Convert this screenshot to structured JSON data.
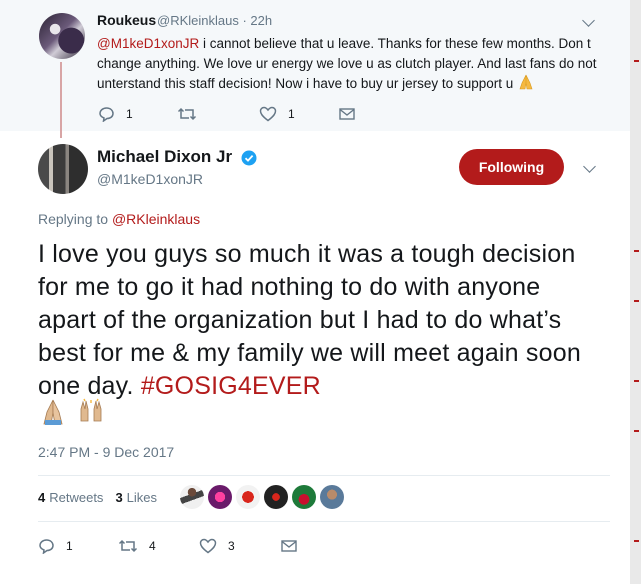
{
  "reply_tweet": {
    "name": "Roukeus",
    "handle": "@RKleinklaus · 22h",
    "mention": "@M1keD1xonJR",
    "text": " i cannot believe that u leave. Thanks for these few months. Don t change anything. We love ur energy we love u as clutch player. And last fans do not unterstand this staff decision! Now i have to buy ur jersey to support u ",
    "reply_count": "1",
    "like_count": "1",
    "retweet_count": ""
  },
  "main_tweet": {
    "name": "Michael Dixon Jr",
    "handle": "@M1keD1xonJR",
    "follow_label": "Following",
    "replying_prefix": "Replying to ",
    "replying_to": "@RKleinklaus",
    "text": "I love you guys so much it was a tough decision for me to go it had nothing to do with anyone apart of the organization but I had to do what’s best for me & my family we will meet again soon one day. ",
    "hashtag": "#GOSIG4EVER",
    "timestamp": "2:47 PM - 9 Dec 2017",
    "retweets_num": "4",
    "retweets_label": "Retweets",
    "likes_num": "3",
    "likes_label": "Likes",
    "reply_count": "1",
    "retweet_count": "4",
    "like_count": "3"
  },
  "colors": {
    "accent": "#b31b1b",
    "muted": "#657786",
    "verified": "#1da1f2"
  },
  "icons": [
    "reply-icon",
    "retweet-icon",
    "heart-icon",
    "mail-icon",
    "verified-icon",
    "chevron-down-icon",
    "folded-hands-emoji",
    "raising-hands-emoji"
  ]
}
